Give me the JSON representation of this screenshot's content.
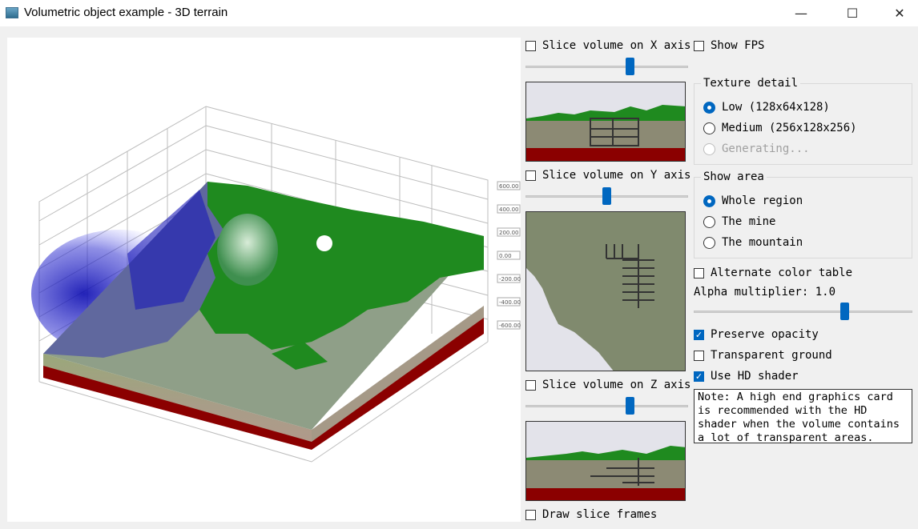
{
  "window": {
    "title": "Volumetric object example - 3D terrain",
    "minimize_glyph": "—",
    "maximize_glyph": "☐",
    "close_glyph": "✕"
  },
  "axis_labels": {
    "right": [
      "600.00",
      "400.00",
      "200.00",
      "0.00",
      "-200.00",
      "-400.00",
      "-600.00"
    ]
  },
  "slices": {
    "x_label": "Slice volume on X axis",
    "x_value": 0.65,
    "y_label": "Slice volume on Y axis",
    "y_value": 0.5,
    "z_label": "Slice volume on Z axis",
    "z_value": 0.65,
    "x_checked": false,
    "y_checked": false,
    "z_checked": false,
    "draw_frames_label": "Draw slice frames",
    "draw_frames_checked": false
  },
  "fps": {
    "label": "Show FPS",
    "checked": false
  },
  "texture_detail": {
    "title": "Texture detail",
    "options": [
      {
        "label": "Low (128x64x128)",
        "selected": true,
        "disabled": false
      },
      {
        "label": "Medium (256x128x256)",
        "selected": false,
        "disabled": false
      },
      {
        "label": "Generating...",
        "selected": false,
        "disabled": true
      }
    ]
  },
  "show_area": {
    "title": "Show area",
    "options": [
      {
        "label": "Whole region",
        "selected": true
      },
      {
        "label": "The mine",
        "selected": false
      },
      {
        "label": "The mountain",
        "selected": false
      }
    ]
  },
  "alt_color": {
    "label": "Alternate color table",
    "checked": false
  },
  "alpha": {
    "label": "Alpha multiplier: 1.0",
    "value": 0.7
  },
  "preserve_opacity": {
    "label": "Preserve opacity",
    "checked": true
  },
  "transparent_ground": {
    "label": "Transparent ground",
    "checked": false
  },
  "hd_shader": {
    "label": "Use HD shader",
    "checked": true
  },
  "note": "Note: A high end graphics card is recommended with the HD shader when the volume contains a lot of transparent areas.",
  "colors": {
    "accent": "#0067c0",
    "terrain_green": "#1f8a1f",
    "ground_red": "#8b0000",
    "water_blue": "#1010c0"
  }
}
